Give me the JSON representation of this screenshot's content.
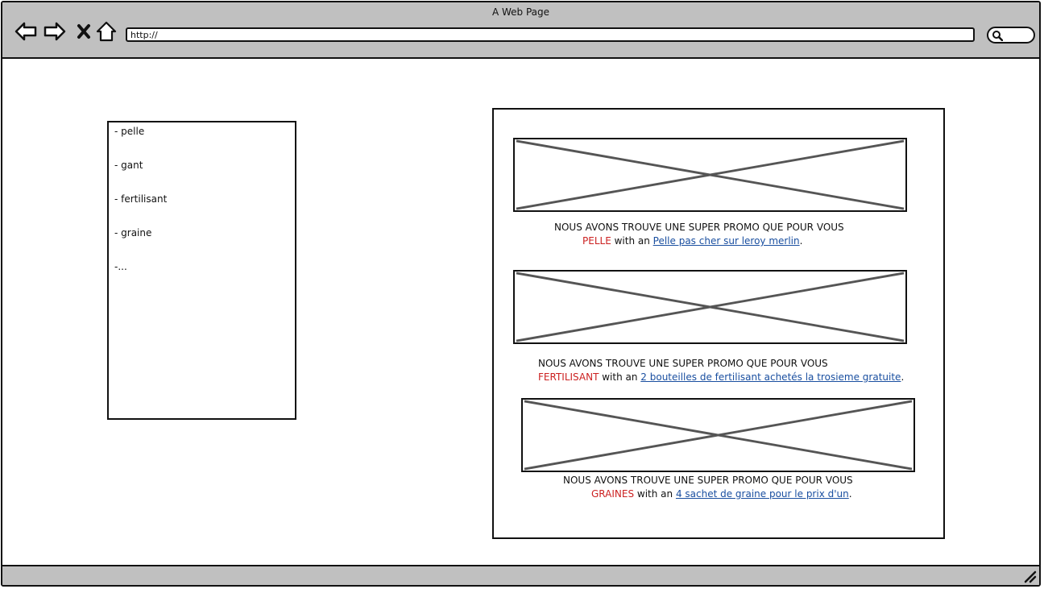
{
  "window": {
    "title": "A Web Page",
    "address_value": "http://"
  },
  "icons": {
    "back": "back-arrow-icon",
    "forward": "forward-arrow-icon",
    "stop": "close-icon",
    "home": "home-icon",
    "search": "search-icon",
    "resize": "resize-grip-icon"
  },
  "sidebar": {
    "items": [
      {
        "label": "- pelle"
      },
      {
        "label": "- gant"
      },
      {
        "label": "- fertilisant"
      },
      {
        "label": "- graine"
      },
      {
        "label": "-..."
      }
    ]
  },
  "promos": [
    {
      "headline": "NOUS AVONS TROUVE UNE SUPER PROMO QUE POUR VOUS",
      "keyword": "PELLE",
      "connector": " with an ",
      "link": "Pelle pas cher sur leroy merlin",
      "suffix": "."
    },
    {
      "headline": "NOUS AVONS TROUVE UNE SUPER PROMO QUE POUR VOUS",
      "keyword": "FERTILISANT",
      "connector": " with an ",
      "link": "2 bouteilles de fertilisant achetés la trosieme gratuite",
      "suffix": "."
    },
    {
      "headline": "NOUS AVONS TROUVE UNE SUPER PROMO QUE POUR VOUS",
      "keyword": "GRAINES",
      "connector": " with an ",
      "link": "4 sachet de graine pour le prix d'un",
      "suffix": "."
    }
  ],
  "colors": {
    "chrome": "#c0c0c0",
    "keyword": "#cc2222",
    "link": "#1a4fa0",
    "placeholder_cross": "#555555"
  }
}
